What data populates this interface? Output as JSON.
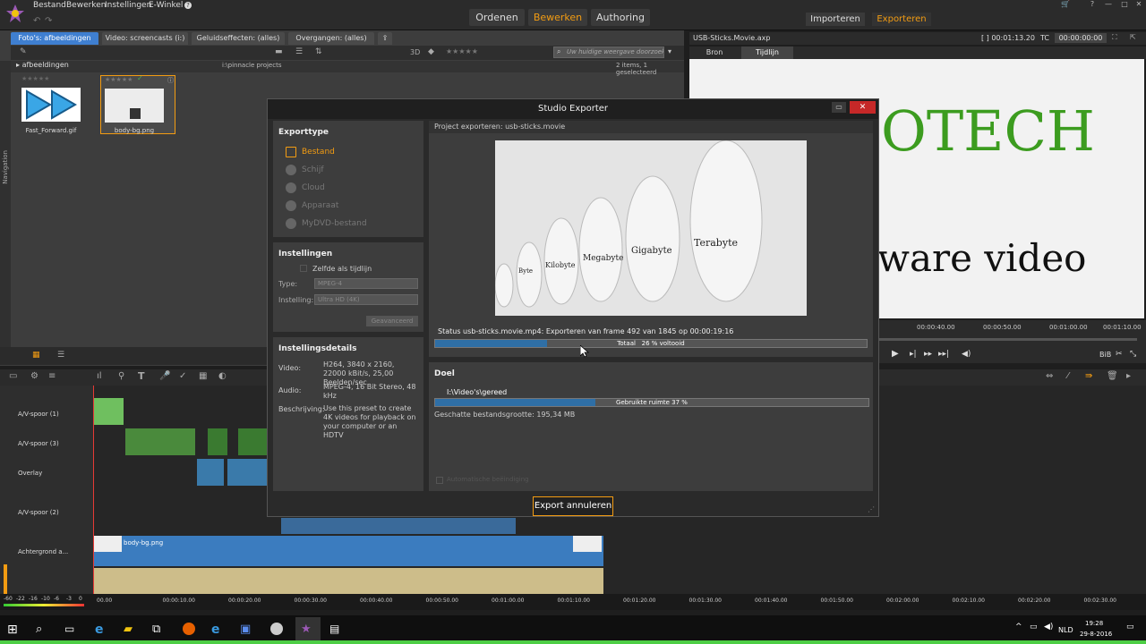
{
  "menu": [
    "Bestand",
    "Bewerken",
    "Instellingen",
    "E-Winkel"
  ],
  "modes": [
    "Ordenen",
    "Bewerken",
    "Authoring"
  ],
  "active_mode": "Bewerken",
  "top_actions": [
    "Importeren",
    "Exporteren"
  ],
  "library": {
    "tabs": [
      "Foto's: afbeeldingen",
      "Video: screencasts (i:)",
      "Geluidseffecten: (alles)",
      "Overgangen: (alles)"
    ],
    "view_label": "3D",
    "search_placeholder": "Uw huidige weergave doorzoeken",
    "folder": "afbeeldingen",
    "path": "i:\\pinnacle projects",
    "count": "2 items, 1 geselecteerd",
    "nav_label": "Navigation",
    "items": [
      {
        "label": "Fast_Forward.gif"
      },
      {
        "label": "body-bg.png"
      }
    ]
  },
  "preview": {
    "title": "USB-Sticks.Movie.axp",
    "timecode_label": "TC",
    "timecode": "[ ] 00:01:13.20",
    "tc_value": "00:00:00:00",
    "tabs": [
      "Bron",
      "Tijdlijn"
    ],
    "active_tab": "Tijdlijn",
    "text_top": "OTECH",
    "text_mid": "ware video",
    "ruler": [
      "00:00:40.00",
      "00:00:50.00",
      "00:01:00.00",
      "00:01:10.00"
    ],
    "bib": "BiB"
  },
  "dialog": {
    "title": "Studio Exporter",
    "exporttype_title": "Exporttype",
    "exporttypes": [
      "Bestand",
      "Schijf",
      "Cloud",
      "Apparaat",
      "MyDVD-bestand"
    ],
    "settings_title": "Instellingen",
    "same_as_timeline": "Zelfde als tijdlijn",
    "type_label": "Type:",
    "type_value": "MPEG-4",
    "setting_label": "Instelling:",
    "setting_value": "Ultra HD (4K)",
    "advanced_btn": "Geavanceerd",
    "details_title": "Instellingsdetails",
    "video_label": "Video:",
    "video_value": "H264, 3840 x 2160, 22000 kBit/s, 25,00 Beelden/sec",
    "audio_label": "Audio:",
    "audio_value": "MPEG-4, 16 Bit Stereo, 48 kHz",
    "desc_label": "Beschrijving:",
    "desc_value": "Use this preset to create 4K videos for playback on your computer or an HDTV",
    "project_label": "Project exporteren: usb-sticks.movie",
    "status": "Status usb-sticks.movie.mp4: Exporteren van frame 492 van 1845 op 00:00:19:16",
    "progress_label": "Totaal",
    "progress_text": "26 % voltooid",
    "progress": 0.26,
    "doel_title": "Doel",
    "path": "I:\\Video's\\gereed",
    "space_label": "Gebruikte ruimte 37 %",
    "space": 0.37,
    "estimate": "Geschatte bestandsgrootte: 195,34 MB",
    "auto_shutdown": "Automatische beëindiging",
    "cancel_btn": "Export annuleren",
    "dolls": [
      "Byte",
      "Kilobyte",
      "Megabyte",
      "Gigabyte",
      "Terabyte"
    ]
  },
  "timeline": {
    "tracks": [
      "A/V-spoor (1)",
      "A/V-spoor (3)",
      "Overlay",
      "A/V-spoor (2)",
      "Achtergrond a..."
    ],
    "clip_label": "body-bg.png",
    "ruler": [
      "00.00",
      "00:00:10.00",
      "00:00:20.00",
      "00:00:30.00",
      "00:00:40.00",
      "00:00:50.00",
      "00:01:00.00",
      "00:01:10.00",
      "00:01:20.00",
      "00:01:30.00",
      "00:01:40.00",
      "00:01:50.00",
      "00:02:00.00",
      "00:02:10.00",
      "00:02:20.00",
      "00:02:30.00"
    ],
    "meter": [
      "-60",
      "-22",
      "-16",
      "-10",
      "-6",
      "-3",
      "0"
    ]
  },
  "taskbar": {
    "lang": "NLD",
    "time": "19:28",
    "date": "29-8-2016"
  }
}
